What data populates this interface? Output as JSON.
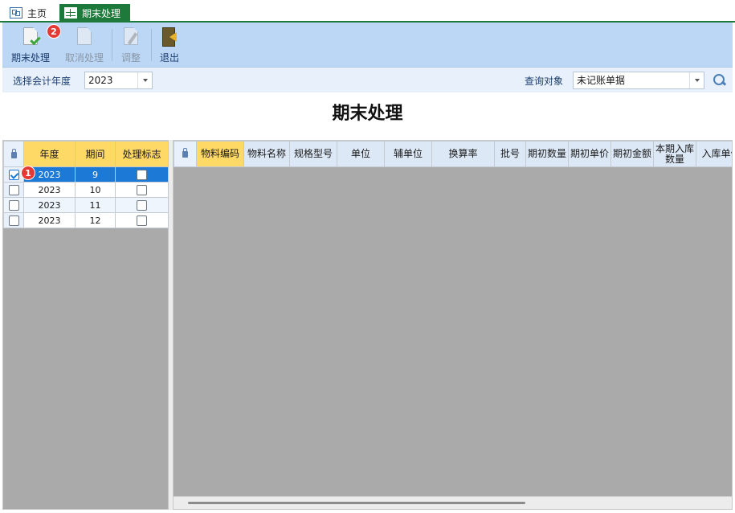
{
  "tabs": [
    {
      "label": "主页",
      "icon": "home-icon"
    },
    {
      "label": "期末处理",
      "icon": "table-icon",
      "active": true
    }
  ],
  "toolbar": {
    "buttons": [
      {
        "label": "期末处理",
        "icon": "document-check-icon",
        "enabled": true
      },
      {
        "label": "取消处理",
        "icon": "document-cancel-icon",
        "enabled": false
      },
      {
        "label": "调整",
        "icon": "document-edit-icon",
        "enabled": false
      },
      {
        "label": "退出",
        "icon": "exit-door-icon",
        "enabled": true
      }
    ],
    "badge": "2"
  },
  "filters": {
    "year_label": "选择会计年度",
    "year_value": "2023",
    "query_label": "查询对象",
    "query_value": "未记账单据"
  },
  "title": "期末处理",
  "period_grid": {
    "headers": [
      "年度",
      "期间",
      "处理标志"
    ],
    "rows": [
      {
        "year": "2023",
        "period": "9",
        "selected": true,
        "processed": false
      },
      {
        "year": "2023",
        "period": "10",
        "selected": false,
        "processed": false
      },
      {
        "year": "2023",
        "period": "11",
        "selected": false,
        "processed": false
      },
      {
        "year": "2023",
        "period": "12",
        "selected": false,
        "processed": false
      }
    ],
    "badge": "1"
  },
  "detail_grid": {
    "headers": [
      "物料编码",
      "物料名称",
      "规格型号",
      "单位",
      "辅单位",
      "换算率",
      "批号",
      "期初数量",
      "期初单价",
      "期初金额",
      "本期入库数量",
      "入库单价"
    ]
  },
  "colors": {
    "accent_green": "#1e7a3a",
    "toolbar_blue": "#bcd7f5",
    "header_yellow": "#ffd966",
    "selection_blue": "#1c7ad6",
    "badge_red": "#e53935"
  }
}
